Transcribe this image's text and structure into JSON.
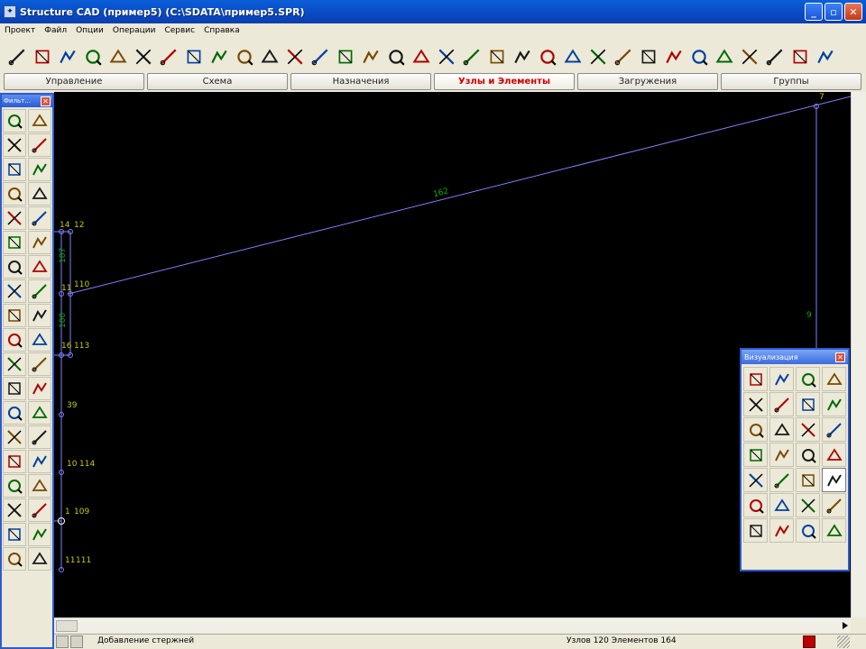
{
  "window": {
    "title": "Structure CAD (пример5) (C:\\SDATA\\пример5.SPR)",
    "minimize": "_",
    "maximize": "▫",
    "close": "✕"
  },
  "menu": [
    "Проект",
    "Файл",
    "Опции",
    "Операции",
    "Сервис",
    "Справка"
  ],
  "toolbar_icons": [
    "node-add-icon",
    "node-move-icon",
    "node-grid-icon",
    "node-select-icon",
    "node-copy-icon",
    "node-merge-icon",
    "node-number-icon",
    "node-coords-icon",
    "node-renumber-icon",
    "node-pack-icon",
    "element-add-icon",
    "element-divide-icon",
    "element-pattern-icon",
    "element-triangle-icon",
    "element-rotate-icon",
    "element-fold-icon",
    "element-check-icon",
    "element-cross-icon",
    "element-stair-icon",
    "element-box-icon",
    "element-ramp-icon",
    "element-frame-icon",
    "element-grid-icon",
    "element-table-icon",
    "element-array-icon",
    "element-square-icon",
    "element-dashed-icon",
    "element-extrude-icon",
    "element-hatch-icon",
    "element-red-icon",
    "element-pin-icon",
    "element-split-icon",
    "element-delete-icon"
  ],
  "tabs": [
    {
      "label": "Управление",
      "active": false
    },
    {
      "label": "Схема",
      "active": false
    },
    {
      "label": "Назначения",
      "active": false
    },
    {
      "label": "Узлы и Элементы",
      "active": true
    },
    {
      "label": "Загружения",
      "active": false
    },
    {
      "label": "Группы",
      "active": false
    }
  ],
  "left_palette": {
    "title": "Фильт...",
    "close": "✕",
    "icons": [
      "pencil-icon",
      "eraser-icon",
      "cube-icon",
      "question-icon",
      "rod-add-icon",
      "rod-delete-icon",
      "rod-select-icon",
      "rod-filter-icon",
      "rod-mark-icon",
      "rod-unmark-icon",
      "plate-add-icon",
      "plate-mesh-icon",
      "axis-cross-icon",
      "axis-angle-icon",
      "parallel-icon",
      "intersect-icon",
      "support-icon",
      "arrow-down-icon",
      "pack-icon",
      "grid-pack-icon",
      "node-link-icon",
      "node-grid-icon",
      "dotted-grid-icon",
      "mesh-icon",
      "bucket-icon",
      "brush-icon",
      "stack-icon",
      "ruler-icon",
      "split-icon",
      "split-x-icon",
      "triangle-mesh-icon",
      "grid-red-icon",
      "palette-icon",
      "chart-icon",
      "beam-icon",
      "tree-icon",
      "scissors-icon",
      "matrix-icon"
    ]
  },
  "viz_panel": {
    "title": "Визуализация",
    "close": "✕",
    "icons": [
      "rotate-icon",
      "rotate-x-icon",
      "rotate-y-icon",
      "rotate-z-icon",
      "pan-icon",
      "flip-icon",
      "mirror-icon",
      "frame-icon",
      "view-front-icon",
      "view-top-icon",
      "view-side-icon",
      "view-iso-icon",
      "solid-icon",
      "solid-color-icon",
      "solid-blue-icon",
      "cut-icon",
      "numbers-icon",
      "table-icon",
      "label-icon",
      "zoom-icon",
      "zoom-red-icon",
      "printer-icon",
      "green-dot-icon",
      "red-dot-icon",
      "image-icon",
      "grid-red-icon",
      "fill-green-icon",
      "blank-icon"
    ],
    "pressed_index": 19
  },
  "canvas": {
    "background": "#000000",
    "rod_color": "#8080ff",
    "node_label_color": "#c8c800",
    "element_label_color": "#00b000",
    "node_labels": [
      "14",
      "12",
      "11",
      "110",
      "16",
      "113",
      "39",
      "10",
      "114",
      "1",
      "109",
      "11",
      "111",
      "7"
    ],
    "element_labels": [
      "162",
      "107",
      "100",
      "9"
    ]
  },
  "statusbar": {
    "message": "Добавление стержней",
    "counts": "Узлов 120 Элементов 164"
  }
}
